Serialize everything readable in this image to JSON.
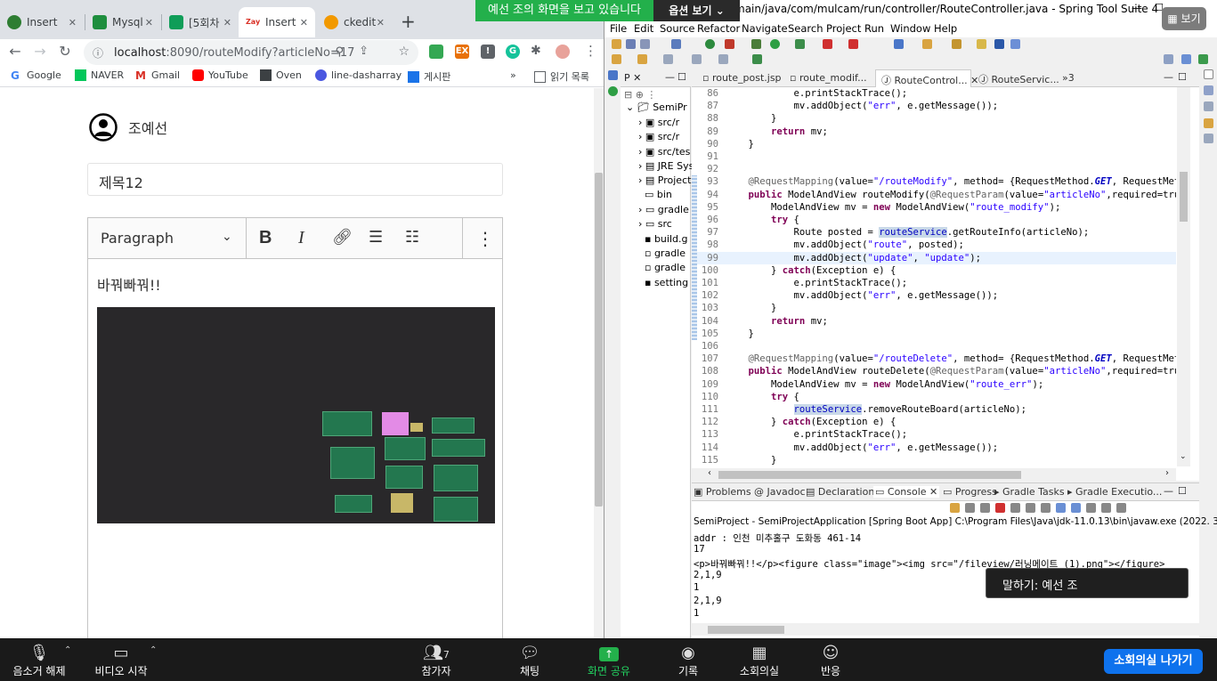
{
  "browser": {
    "tabs": [
      {
        "label": "Insert"
      },
      {
        "label": "Mysql"
      },
      {
        "label": "[5회차"
      },
      {
        "label": "Insert"
      },
      {
        "label": "ckedit"
      }
    ],
    "new_tab": "+",
    "url_host": "localhost",
    "url_rest": ":8090/routeModify?articleNo=17",
    "bookmarks": [
      {
        "label": "Google"
      },
      {
        "label": "NAVER"
      },
      {
        "label": "Gmail"
      },
      {
        "label": "YouTube"
      },
      {
        "label": "Oven"
      },
      {
        "label": "line-dasharray"
      },
      {
        "label": "게시판"
      }
    ],
    "reading_list": "읽기 목록"
  },
  "page": {
    "author": "조예선",
    "title": "제목12",
    "editor": {
      "format": "Paragraph",
      "body_text": "바꿔빠꿔!!"
    }
  },
  "eclipse": {
    "window_title": "main/java/com/mulcam/run/controller/RouteController.java - Spring Tool Suite 4",
    "menu": [
      "File",
      "Edit",
      "Source",
      "Refactor",
      "Navigate",
      "Search",
      "Project",
      "Run",
      "Window",
      "Help"
    ],
    "explorer_tab": "P",
    "explorer_items": [
      "SemiPr",
      "src/r",
      "src/r",
      "src/tes",
      "JRE Sys",
      "Project",
      "bin",
      "gradle",
      "src",
      "build.g",
      "gradle",
      "gradle",
      "setting"
    ],
    "editor_tabs": [
      "route_post.jsp",
      "route_modif...",
      "RouteControl...",
      "RouteServic...",
      "»3"
    ],
    "code_lines": [
      {
        "n": "86",
        "code": "            e.printStackTrace();"
      },
      {
        "n": "87",
        "code": "            mv.addObject(\"err\", e.getMessage());"
      },
      {
        "n": "88",
        "code": "        }"
      },
      {
        "n": "89",
        "code": "        return mv;"
      },
      {
        "n": "90",
        "code": "    }"
      },
      {
        "n": "91",
        "code": ""
      },
      {
        "n": "92",
        "code": ""
      },
      {
        "n": "93",
        "code": "    @RequestMapping(value=\"/routeModify\", method= {RequestMethod.GET, RequestMet"
      },
      {
        "n": "94",
        "code": "    public ModelAndView routeModify(@RequestParam(value=\"articleNo\",required=tru"
      },
      {
        "n": "95",
        "code": "        ModelAndView mv = new ModelAndView(\"route_modify\");"
      },
      {
        "n": "96",
        "code": "        try {"
      },
      {
        "n": "97",
        "code": "            Route posted = routeService.getRouteInfo(articleNo);"
      },
      {
        "n": "98",
        "code": "            mv.addObject(\"route\", posted);"
      },
      {
        "n": "99",
        "code": "            mv.addObject(\"update\", \"update\");"
      },
      {
        "n": "100",
        "code": "        } catch(Exception e) {"
      },
      {
        "n": "101",
        "code": "            e.printStackTrace();"
      },
      {
        "n": "102",
        "code": "            mv.addObject(\"err\", e.getMessage());"
      },
      {
        "n": "103",
        "code": "        }"
      },
      {
        "n": "104",
        "code": "        return mv;"
      },
      {
        "n": "105",
        "code": "    }"
      },
      {
        "n": "106",
        "code": ""
      },
      {
        "n": "107",
        "code": "    @RequestMapping(value=\"/routeDelete\", method= {RequestMethod.GET, RequestMet"
      },
      {
        "n": "108",
        "code": "    public ModelAndView routeDelete(@RequestParam(value=\"articleNo\",required=tru"
      },
      {
        "n": "109",
        "code": "        ModelAndView mv = new ModelAndView(\"route_err\");"
      },
      {
        "n": "110",
        "code": "        try {"
      },
      {
        "n": "111",
        "code": "            routeService.removeRouteBoard(articleNo);"
      },
      {
        "n": "112",
        "code": "        } catch(Exception e) {"
      },
      {
        "n": "113",
        "code": "            e.printStackTrace();"
      },
      {
        "n": "114",
        "code": "            mv.addObject(\"err\", e.getMessage());"
      },
      {
        "n": "115",
        "code": "        }"
      }
    ],
    "console_tabs": [
      "Problems",
      "Javadoc",
      "Declaration",
      "Console",
      "Progress",
      "Gradle Tasks",
      "Gradle Executio..."
    ],
    "console_title": "SemiProject - SemiProjectApplication [Spring Boot App] C:\\Program Files\\Java\\jdk-11.0.13\\bin\\javaw.exe  (2022. 3",
    "console_lines": [
      "addr : 인천 미추홀구 도화동 461-14",
      "17",
      "<p>바꿔빠꿔!!</p><figure class=\"image\"><img src=\"/fileview/러닝메이트 (1).png\"></figure>",
      "2,1,9",
      "1",
      "2,1,9",
      "1"
    ]
  },
  "share_banner": "예선 조의 화면을 보고 있습니다",
  "view_options": "옵션 보기 ⌄",
  "speaking": "말하기: 예선 조",
  "view_btn": "보기",
  "zoom_bar": {
    "mute": "음소거 해제",
    "video": "비디오 시작",
    "participants": "참가자",
    "participant_count": "7",
    "chat": "채팅",
    "share": "화면 공유",
    "record": "기록",
    "breakout": "소회의실",
    "reactions": "반응",
    "leave": "소회의실 나가기"
  }
}
